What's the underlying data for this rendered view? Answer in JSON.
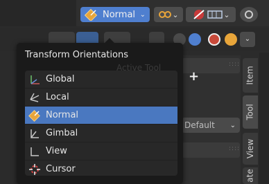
{
  "header": {
    "orientation_button_label": "Normal",
    "chevron": "⌄"
  },
  "popup": {
    "title": "Transform Orientations",
    "ghost_text": "Active Tool",
    "add_label": "+",
    "items": [
      {
        "label": "Global",
        "icon": "global-orientation-icon",
        "selected": false
      },
      {
        "label": "Local",
        "icon": "local-orientation-icon",
        "selected": false
      },
      {
        "label": "Normal",
        "icon": "normal-orientation-icon",
        "selected": true
      },
      {
        "label": "Gimbal",
        "icon": "gimbal-orientation-icon",
        "selected": false
      },
      {
        "label": "View",
        "icon": "view-orientation-icon",
        "selected": false
      },
      {
        "label": "Cursor",
        "icon": "cursor-orientation-icon",
        "selected": false
      }
    ]
  },
  "side_panel": {
    "dropdown_value": "Default"
  },
  "tabs": [
    "Item",
    "Tool",
    "View",
    "ate"
  ],
  "colors": {
    "accent": "#4a78c0",
    "popup_bg": "#1a1a1a",
    "header_bg": "#2f2f2f"
  }
}
